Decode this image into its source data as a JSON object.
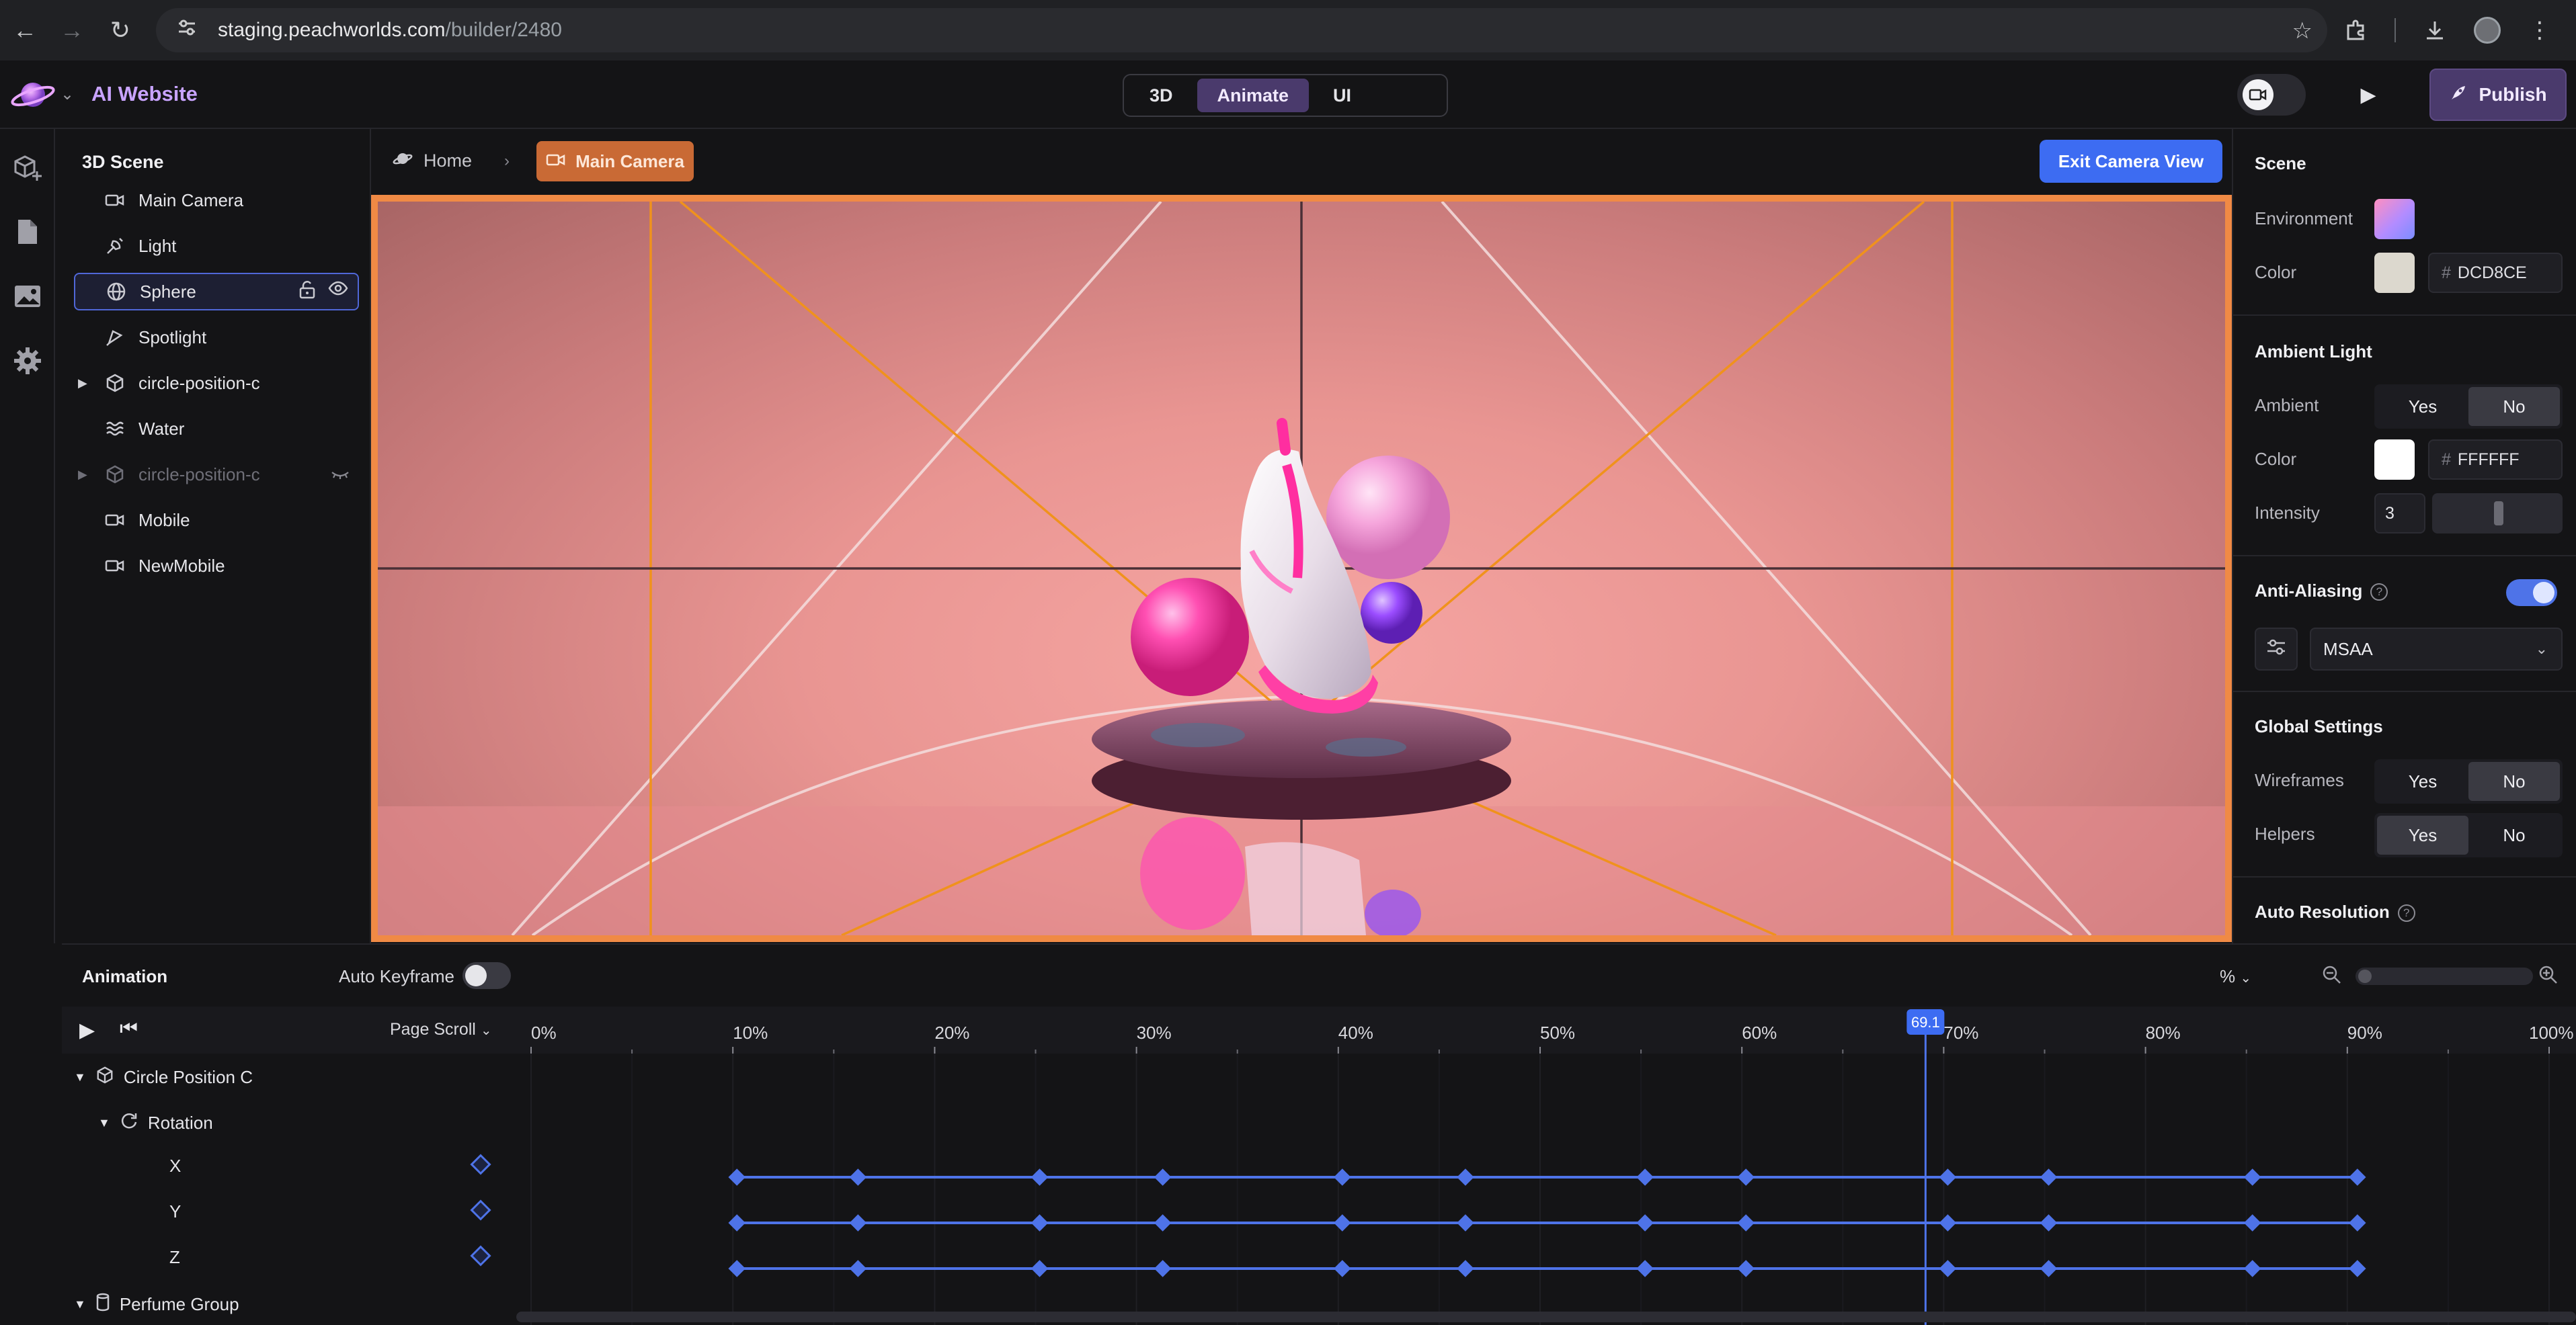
{
  "browser": {
    "url_host": "staging.peachworlds.com",
    "url_path": "/builder/2480"
  },
  "header": {
    "app_title": "AI Website",
    "mode_tabs": [
      {
        "label": "3D",
        "active": false
      },
      {
        "label": "Animate",
        "active": true
      },
      {
        "label": "UI",
        "active": false
      }
    ],
    "publish_label": "Publish",
    "accent": "#4a3a6c"
  },
  "scene_tree": {
    "title": "3D Scene",
    "items": [
      {
        "label": "Main Camera",
        "icon": "camera-icon",
        "expandable": false,
        "selected": false,
        "hidden": false
      },
      {
        "label": "Light",
        "icon": "light-icon",
        "expandable": false,
        "selected": false,
        "hidden": false
      },
      {
        "label": "Sphere",
        "icon": "globe-icon",
        "expandable": false,
        "selected": true,
        "hidden": false
      },
      {
        "label": "Spotlight",
        "icon": "spotlight-icon",
        "expandable": false,
        "selected": false,
        "hidden": false
      },
      {
        "label": "circle-position-c",
        "icon": "cube-icon",
        "expandable": true,
        "selected": false,
        "hidden": false
      },
      {
        "label": "Water",
        "icon": "water-icon",
        "expandable": false,
        "selected": false,
        "hidden": false
      },
      {
        "label": "circle-position-c",
        "icon": "cube-icon",
        "expandable": true,
        "selected": false,
        "hidden": true
      },
      {
        "label": "Mobile",
        "icon": "camera-icon",
        "expandable": false,
        "selected": false,
        "hidden": false
      },
      {
        "label": "NewMobile",
        "icon": "camera-icon",
        "expandable": false,
        "selected": false,
        "hidden": false
      }
    ]
  },
  "viewport": {
    "breadcrumb_home": "Home",
    "breadcrumb_current": "Main Camera",
    "exit_label": "Exit Camera View",
    "frame_color": "#f08a45"
  },
  "properties": {
    "scene_title": "Scene",
    "environment_label": "Environment",
    "color_label": "Color",
    "scene_color_hex": "DCD8CE",
    "scene_color": "#dcd8ce",
    "ambient_title": "Ambient Light",
    "ambient_label": "Ambient",
    "ambient_yes": "Yes",
    "ambient_no": "No",
    "ambient_selected": "No",
    "ambient_color_label": "Color",
    "ambient_color_hex": "FFFFFF",
    "intensity_label": "Intensity",
    "intensity_value": "3",
    "antialias_label": "Anti-Aliasing",
    "antialias_enabled": true,
    "antialias_mode": "MSAA",
    "global_title": "Global Settings",
    "wireframes_label": "Wireframes",
    "wireframes_yes": "Yes",
    "wireframes_no": "No",
    "wireframes_selected": "No",
    "helpers_label": "Helpers",
    "helpers_yes": "Yes",
    "helpers_no": "No",
    "helpers_selected": "Yes",
    "auto_res_label": "Auto Resolution"
  },
  "animation": {
    "title": "Animation",
    "auto_keyframe_label": "Auto Keyframe",
    "auto_keyframe_on": false,
    "unit": "%",
    "scroll_mode": "Page Scroll",
    "ruler": [
      "0%",
      "10%",
      "20%",
      "30%",
      "40%",
      "50%",
      "60%",
      "70%",
      "80%",
      "90%",
      "100%"
    ],
    "playhead_value": "69.1",
    "playhead_percent": 69.1,
    "tracks": [
      {
        "label": "Circle Position C",
        "level": 0,
        "icon": "cube-icon"
      },
      {
        "label": "Rotation",
        "level": 1,
        "icon": "rotate-icon"
      },
      {
        "label": "X",
        "level": 2
      },
      {
        "label": "Y",
        "level": 2
      },
      {
        "label": "Z",
        "level": 2
      },
      {
        "label": "Perfume Group",
        "level": 0,
        "icon": "cylinder-icon"
      }
    ],
    "keyframe_percents": [
      10.2,
      16.2,
      25.2,
      31.3,
      40.2,
      46.3,
      55.2,
      60.2,
      70.2,
      75.2,
      85.3,
      90.5
    ],
    "keyframe_color": "#4e73e8"
  }
}
